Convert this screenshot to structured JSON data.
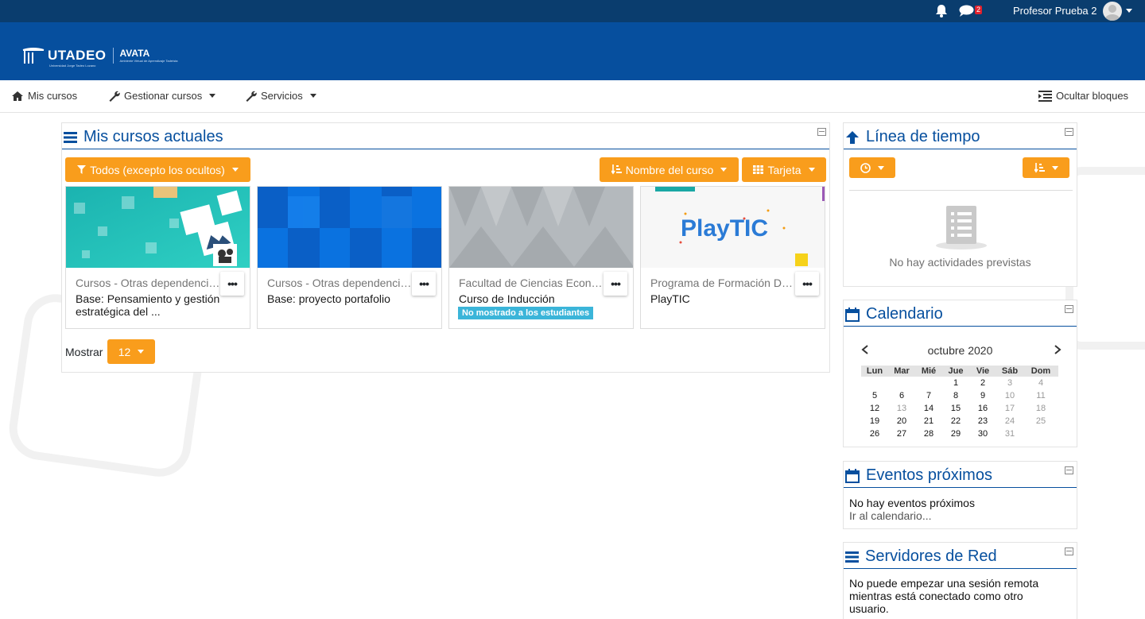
{
  "topbar": {
    "notification_icon": "bell-icon",
    "messages_icon": "chat-icon",
    "messages_count": "2",
    "username": "Profesor Prueba 2"
  },
  "header": {
    "logo_text": "UTADEO",
    "logo_subtext": "Universidad Jorge Tadeo Lozano",
    "app_name": "AVATA",
    "app_subtext": "Ambiente Virtual de Aprendizaje Tadeísta"
  },
  "nav": {
    "my_courses": "Mis cursos",
    "manage_courses": "Gestionar cursos",
    "services": "Servicios",
    "hide_blocks": "Ocultar bloques"
  },
  "courses_block": {
    "title": "Mis cursos actuales",
    "filter_label": "Todos (excepto los ocultos)",
    "sort_label": "Nombre del curso",
    "view_label": "Tarjeta",
    "show_label": "Mostrar",
    "show_count": "12",
    "menu_glyph": "•••",
    "cards": [
      {
        "category": "Cursos - Otras dependencias",
        "name": "Base: Pensamiento y gestión estratégica del ...",
        "badge": ""
      },
      {
        "category": "Cursos - Otras dependencias",
        "name": "Base: proyecto portafolio",
        "badge": ""
      },
      {
        "category": "Facultad de Ciencias Económicas",
        "name": "Curso de Inducción",
        "badge": "No mostrado a los estudiantes"
      },
      {
        "category": "Programa de Formación Docente",
        "name": "PlayTIC",
        "badge": ""
      }
    ],
    "playtic_logo_text": "PlayTIC"
  },
  "timeline_block": {
    "title": "Línea de tiempo",
    "empty_text": "No hay actividades previstas"
  },
  "calendar_block": {
    "title": "Calendario",
    "month": "octubre 2020",
    "weekdays": [
      "Lun",
      "Mar",
      "Mié",
      "Jue",
      "Vie",
      "Sáb",
      "Dom"
    ],
    "weeks": [
      [
        "",
        "",
        "",
        "1",
        "2",
        "3",
        "4"
      ],
      [
        "5",
        "6",
        "7",
        "8",
        "9",
        "10",
        "11"
      ],
      [
        "12",
        "13",
        "14",
        "15",
        "16",
        "17",
        "18"
      ],
      [
        "19",
        "20",
        "21",
        "22",
        "23",
        "24",
        "25"
      ],
      [
        "26",
        "27",
        "28",
        "29",
        "30",
        "31",
        ""
      ]
    ]
  },
  "events_block": {
    "title": "Eventos próximos",
    "empty_text": "No hay eventos próximos",
    "calendar_link": "Ir al calendario..."
  },
  "network_block": {
    "title": "Servidores de Red",
    "message": "No puede empezar una sesión remota mientras está conectado como otro usuario."
  },
  "colors": {
    "topbar": "#0a3d6e",
    "banner": "#064f9e",
    "accent": "#f99d1c",
    "badge": "#3bb5d9"
  }
}
